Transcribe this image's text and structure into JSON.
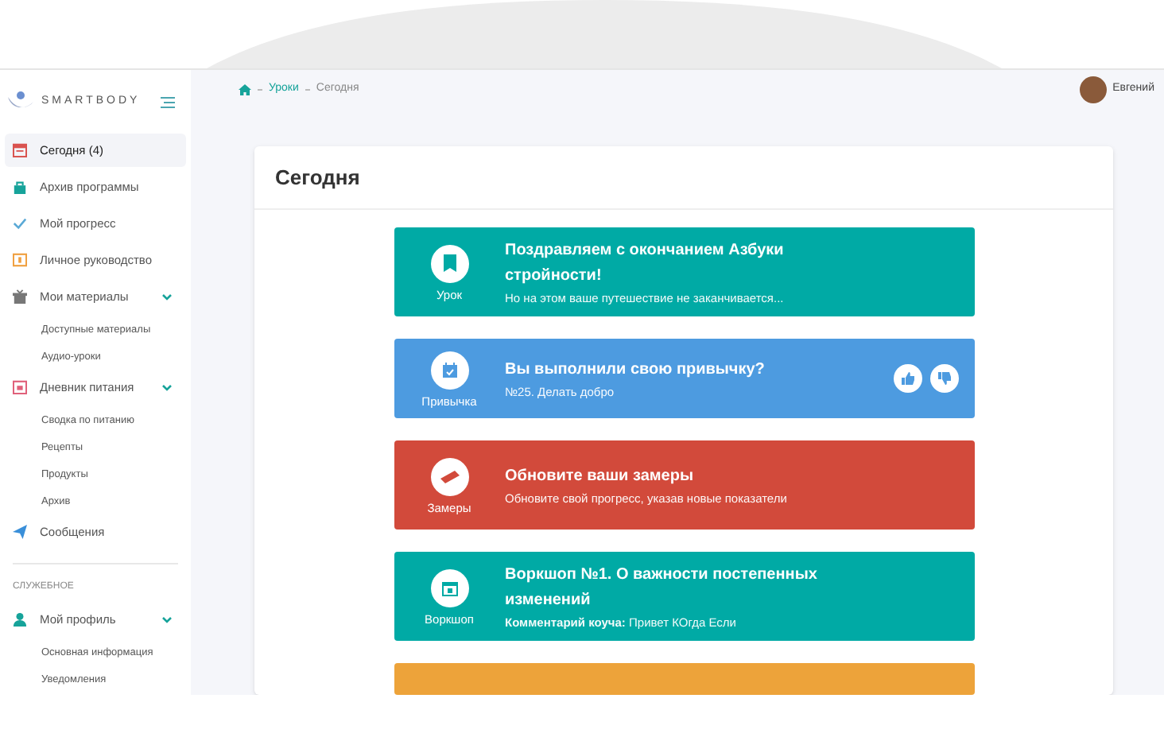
{
  "sidebar": {
    "logo": "SMARTBODY",
    "items": [
      {
        "label": "Сегодня (4)",
        "color": "#d9534f",
        "selected": true
      },
      {
        "label": "Архив программы",
        "color": "#16a39a",
        "selected": false
      },
      {
        "label": "Мой прогресс",
        "color": "#5aa9d6",
        "selected": false
      },
      {
        "label": "Личное руководство",
        "color": "#f0a040",
        "selected": false
      },
      {
        "label": "Мои материалы",
        "color": "#777777",
        "selected": false,
        "expanded": true,
        "children": [
          {
            "label": "Доступные материалы"
          },
          {
            "label": "Аудио-уроки"
          }
        ]
      },
      {
        "label": "Дневник питания",
        "color": "#e0607a",
        "selected": false,
        "expanded": true,
        "children": [
          {
            "label": "Сводка по питанию"
          },
          {
            "label": "Рецепты"
          },
          {
            "label": "Продукты"
          },
          {
            "label": "Архив"
          }
        ]
      },
      {
        "label": "Сообщения",
        "color": "#3a8fd9",
        "selected": false
      }
    ],
    "section": "СЛУЖЕБНОЕ",
    "section_items": [
      {
        "label": "Мой профиль",
        "color": "#16a39a",
        "selected": false,
        "expanded": true,
        "children": [
          {
            "label": "Основная информация"
          },
          {
            "label": "Уведомления"
          }
        ]
      }
    ]
  },
  "breadcrumbs": [
    {
      "label": "Уроки",
      "link": true
    },
    {
      "label": "Сегодня",
      "link": false
    }
  ],
  "user": {
    "name": "Евгений"
  },
  "card": {
    "title": "Сегодня"
  },
  "feed": [
    {
      "kind": "lesson",
      "color": "#00aaa5",
      "label": "Урок",
      "title": "Поздравляем с окончанием Азбуки стройности!",
      "subtitle": "Но на этом ваше путешествие не заканчивается..."
    },
    {
      "kind": "habit",
      "color": "#4d9be0",
      "label": "Привычка",
      "title": "Вы выполнили свою привычку?",
      "subtitle": "№25. Делать добро",
      "actions": true
    },
    {
      "kind": "measure",
      "color": "#d24a3b",
      "label": "Замеры",
      "title": "Обновите ваши замеры",
      "subtitle": "Обновите свой прогресс, указав новые показатели"
    },
    {
      "kind": "workshop",
      "color": "#00aaa5",
      "label": "Воркшоп",
      "title": "Воркшоп №1. О важности постепенных изменений",
      "subtitle": "**Комментарий коуча:** Привет КОгда Если"
    },
    {
      "kind": "partial",
      "color": "#eda33a"
    }
  ]
}
